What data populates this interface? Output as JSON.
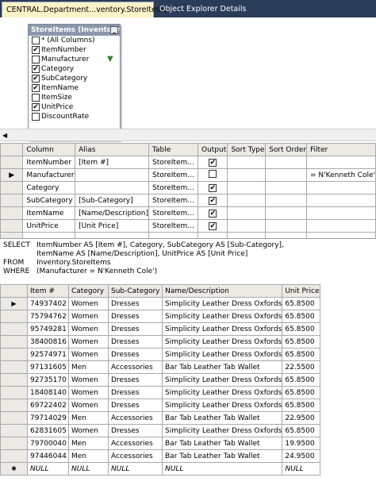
{
  "tabs": [
    {
      "label": "CENTRAL.Department...ventory.StoreItems",
      "active": true
    },
    {
      "label": "Object Explorer Details",
      "active": false
    }
  ],
  "diagram": {
    "table_title": "StoreItems (Inventory",
    "minimize_glyph": "_",
    "columns": [
      {
        "label": "* (All Columns)",
        "checked": false
      },
      {
        "label": "ItemNumber",
        "checked": true
      },
      {
        "label": "Manufacturer",
        "checked": false,
        "filtered": true
      },
      {
        "label": "Category",
        "checked": true
      },
      {
        "label": "SubCategory",
        "checked": true
      },
      {
        "label": "ItemName",
        "checked": true
      },
      {
        "label": "ItemSize",
        "checked": false
      },
      {
        "label": "UnitPrice",
        "checked": true
      },
      {
        "label": "DiscountRate",
        "checked": false
      }
    ]
  },
  "criteria": {
    "headers": [
      "Column",
      "Alias",
      "Table",
      "Output",
      "Sort Type",
      "Sort Order",
      "Filter"
    ],
    "rows": [
      {
        "column": "ItemNumber",
        "alias": "[Item #]",
        "table": "StoreItem...",
        "output": true,
        "sort_type": "",
        "sort_order": "",
        "filter": ""
      },
      {
        "column": "Manufacturer",
        "alias": "",
        "table": "StoreItem...",
        "output": false,
        "sort_type": "",
        "sort_order": "",
        "filter": "= N'Kenneth Cole'",
        "current": true
      },
      {
        "column": "Category",
        "alias": "",
        "table": "StoreItem...",
        "output": true,
        "sort_type": "",
        "sort_order": "",
        "filter": ""
      },
      {
        "column": "SubCategory",
        "alias": "[Sub-Category]",
        "table": "StoreItem...",
        "output": true,
        "sort_type": "",
        "sort_order": "",
        "filter": ""
      },
      {
        "column": "ItemName",
        "alias": "[Name/Description]",
        "table": "StoreItem...",
        "output": true,
        "sort_type": "",
        "sort_order": "",
        "filter": ""
      },
      {
        "column": "UnitPrice",
        "alias": "[Unit Price]",
        "table": "StoreItem...",
        "output": true,
        "sort_type": "",
        "sort_order": "",
        "filter": ""
      }
    ],
    "check_glyph": "✔",
    "current_row_glyph": "▶",
    "scroll_left_glyph": "◀"
  },
  "sql": [
    {
      "keyword": "SELECT",
      "text": "ItemNumber AS [Item #], Category, SubCategory AS [Sub-Category],"
    },
    {
      "keyword": "",
      "text": "ItemName AS [Name/Description], UnitPrice AS [Unit Price]"
    },
    {
      "keyword": "FROM",
      "text": "Inventory.StoreItems"
    },
    {
      "keyword": "WHERE",
      "text": "(Manufacturer = N'Kenneth Cole')"
    }
  ],
  "results": {
    "headers": [
      "Item #",
      "Category",
      "Sub-Category",
      "Name/Description",
      "Unit Price"
    ],
    "current_row_glyph": "▶",
    "new_row_glyph": "✱",
    "rows": [
      [
        "74937402",
        "Women",
        "Dresses",
        "Simplicity Leather Dress Oxfords",
        "65.8500"
      ],
      [
        "75794762",
        "Women",
        "Dresses",
        "Simplicity Leather Dress Oxfords",
        "65.8500"
      ],
      [
        "95749281",
        "Women",
        "Dresses",
        "Simplicity Leather Dress Oxfords",
        "65.8500"
      ],
      [
        "38400816",
        "Women",
        "Dresses",
        "Simplicity Leather Dress Oxfords",
        "65.8500"
      ],
      [
        "92574971",
        "Women",
        "Dresses",
        "Simplicity Leather Dress Oxfords",
        "65.8500"
      ],
      [
        "97131605",
        "Men",
        "Accessories",
        "Bar Tab Leather Tab Wallet",
        "22.5500"
      ],
      [
        "92735170",
        "Women",
        "Dresses",
        "Simplicity Leather Dress Oxfords",
        "65.8500"
      ],
      [
        "18408140",
        "Women",
        "Dresses",
        "Simplicity Leather Dress Oxfords",
        "65.8500"
      ],
      [
        "69722402",
        "Women",
        "Dresses",
        "Simplicity Leather Dress Oxfords",
        "65.8500"
      ],
      [
        "79714029",
        "Men",
        "Accessories",
        "Bar Tab Leather Tab Wallet",
        "22.9500"
      ],
      [
        "62831605",
        "Women",
        "Dresses",
        "Simplicity Leather Dress Oxfords",
        "65.8500"
      ],
      [
        "79700040",
        "Men",
        "Accessories",
        "Bar Tab Leather Tab Wallet",
        "19.9500"
      ],
      [
        "97446044",
        "Men",
        "Accessories",
        "Bar Tab Leather Tab Wallet",
        "24.9500"
      ]
    ],
    "null_row": [
      "NULL",
      "NULL",
      "NULL",
      "NULL",
      "NULL"
    ]
  },
  "colors": {
    "tab_strip": "#2b3c59",
    "active_tab": "#fbf3c8",
    "table_title": "#8c97ab",
    "header_bg": "#eceae4"
  }
}
